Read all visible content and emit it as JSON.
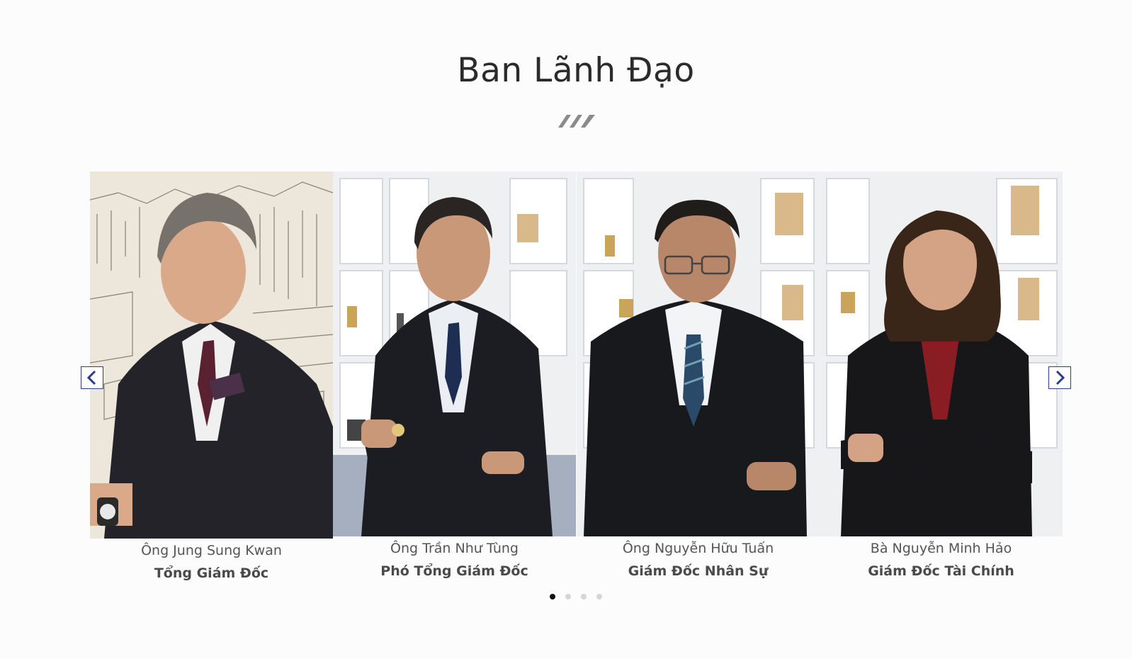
{
  "section": {
    "title": "Ban Lãnh Đạo",
    "divider_icon": "triple-chevron-logo-icon"
  },
  "carousel": {
    "prev_icon": "chevron-left-icon",
    "next_icon": "chevron-right-icon",
    "members": [
      {
        "name": "Ông Jung Sung Kwan",
        "role": "Tổng Giám Đốc"
      },
      {
        "name": "Ông Trần Như Tùng",
        "role": "Phó Tổng Giám Đốc"
      },
      {
        "name": "Ông Nguyễn Hữu Tuấn",
        "role": "Giám Đốc Nhân Sự"
      },
      {
        "name": "Bà Nguyễn Minh Hảo",
        "role": "Giám Đốc Tài Chính"
      }
    ],
    "pagination": {
      "total": 4,
      "active": 1
    }
  },
  "colors": {
    "accent": "#2d3d86",
    "title": "#2b2b2b",
    "background": "#fcfcfc"
  }
}
